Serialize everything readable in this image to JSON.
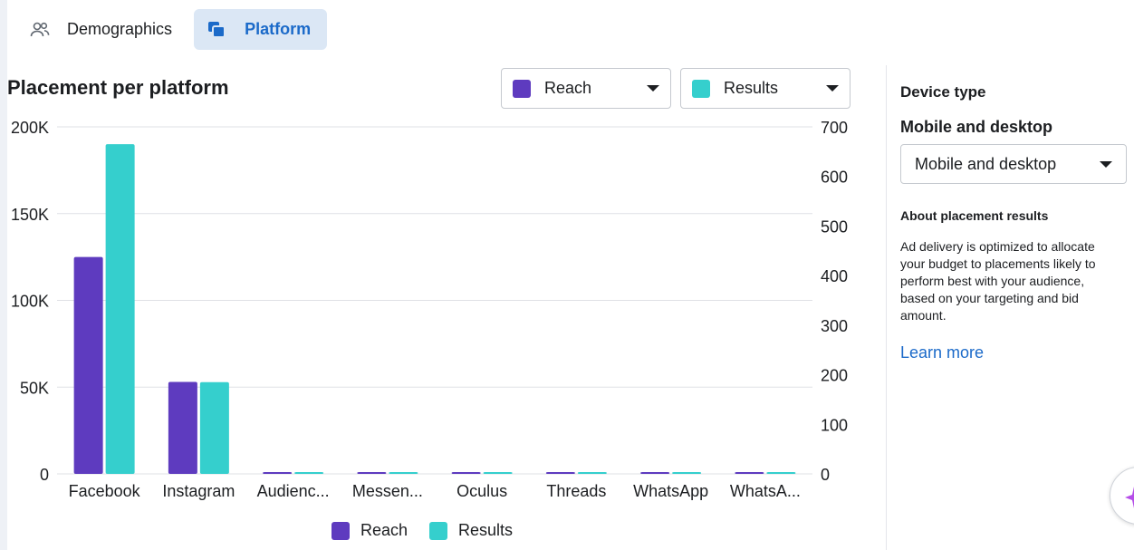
{
  "tabs": [
    {
      "label": "Demographics",
      "icon": "people-icon",
      "active": false
    },
    {
      "label": "Platform",
      "icon": "platform-icon",
      "active": true
    }
  ],
  "chart_header": {
    "title": "Placement per platform",
    "metric_left": {
      "label": "Reach",
      "color": "#5e3bbf"
    },
    "metric_right": {
      "label": "Results",
      "color": "#35cfcd"
    }
  },
  "chart_data": {
    "type": "bar",
    "title": "Placement per platform",
    "categories": [
      "Facebook",
      "Instagram",
      "Audienc...",
      "Messen...",
      "Oculus",
      "Threads",
      "WhatsApp",
      "WhatsA..."
    ],
    "series": [
      {
        "name": "Reach",
        "axis": "left",
        "color": "#5e3bbf",
        "values": [
          125000,
          53000,
          0,
          0,
          0,
          0,
          0,
          0
        ]
      },
      {
        "name": "Results",
        "axis": "right",
        "color": "#35cfcd",
        "values": [
          665,
          185,
          0,
          0,
          0,
          0,
          0,
          0
        ]
      }
    ],
    "y_left": {
      "ylim": [
        0,
        200000
      ],
      "ticks": [
        "0",
        "50K",
        "100K",
        "150K",
        "200K"
      ],
      "tick_values": [
        0,
        50000,
        100000,
        150000,
        200000
      ]
    },
    "y_right": {
      "ylim": [
        0,
        700
      ],
      "ticks": [
        "0",
        "100",
        "200",
        "300",
        "400",
        "500",
        "600",
        "700"
      ],
      "tick_values": [
        0,
        100,
        200,
        300,
        400,
        500,
        600,
        700
      ]
    },
    "grid": true,
    "legend": "bottom-center"
  },
  "legend": [
    {
      "label": "Reach",
      "color": "#5e3bbf"
    },
    {
      "label": "Results",
      "color": "#35cfcd"
    }
  ],
  "side_panel": {
    "title": "Device type",
    "subhead": "Mobile and desktop",
    "select_value": "Mobile and desktop",
    "about_title": "About placement results",
    "about_text": "Ad delivery is optimized to allocate your budget to placements likely to perform best with your audience, based on your targeting and bid amount.",
    "learn_more": "Learn more"
  }
}
